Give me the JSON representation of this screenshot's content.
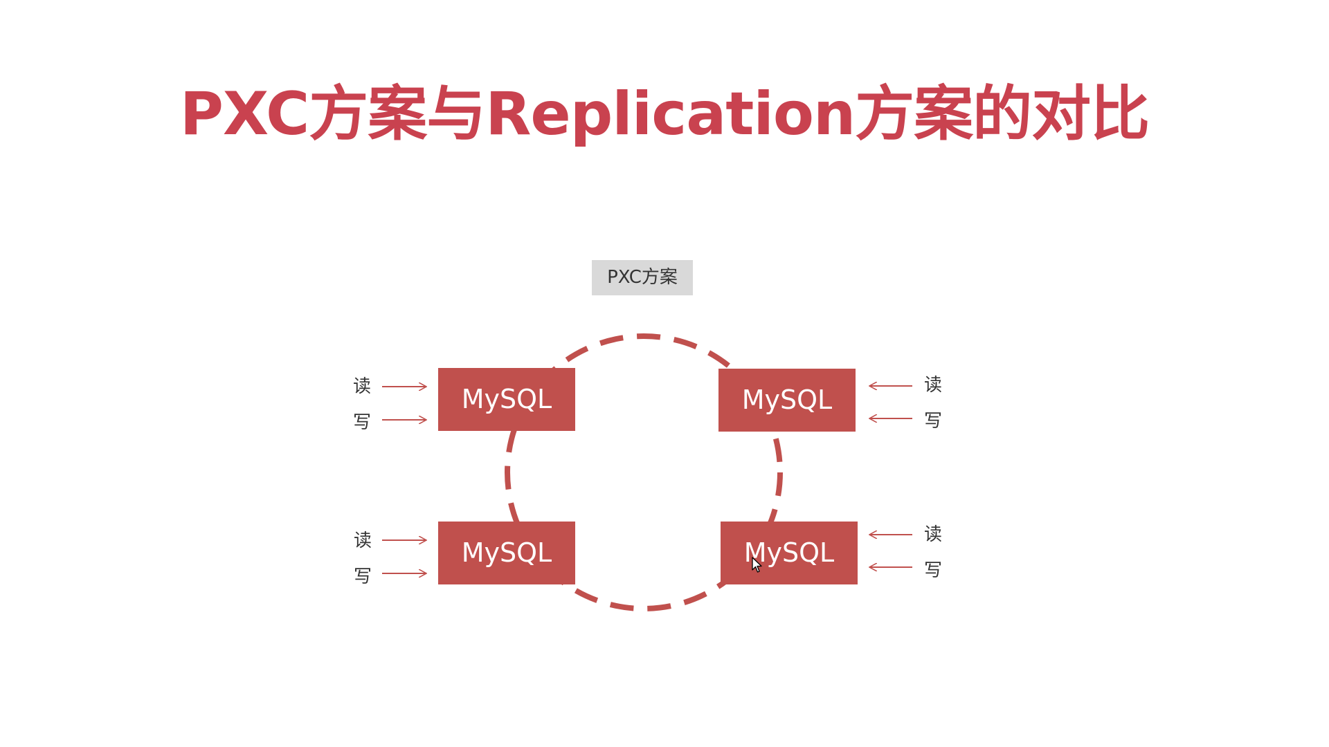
{
  "slide": {
    "title": "PXC方案与Replication方案的对比",
    "scheme_label": "PXC方案"
  },
  "nodes": [
    {
      "label": "MySQL"
    },
    {
      "label": "MySQL"
    },
    {
      "label": "MySQL"
    },
    {
      "label": "MySQL"
    }
  ],
  "io_labels": {
    "read": "读",
    "write": "写"
  },
  "colors": {
    "title": "#c9424f",
    "node_fill": "#c0504d",
    "ring": "#c0504d",
    "arrow": "#c0504d",
    "label_bg": "#d9d9d9"
  },
  "icons": {
    "cursor": "mouse-pointer-icon"
  }
}
